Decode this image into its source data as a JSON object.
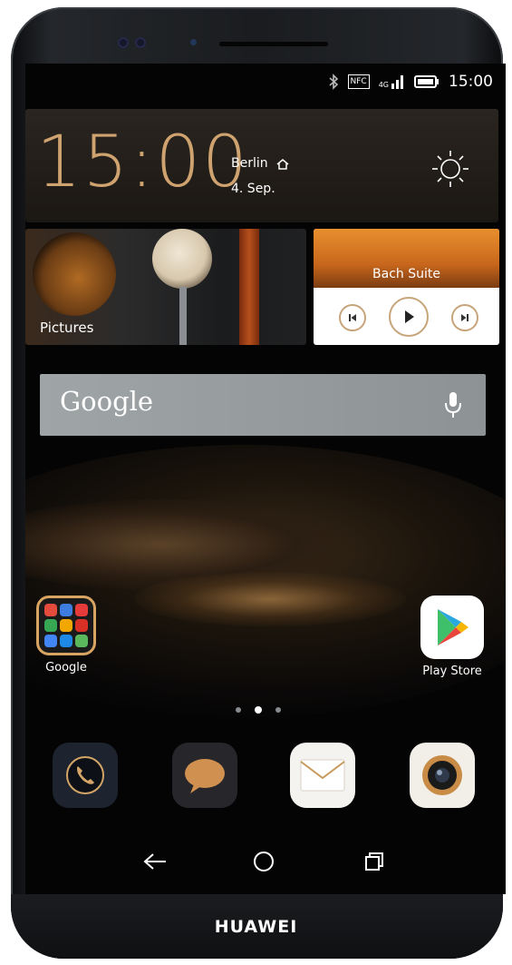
{
  "status_bar": {
    "time": "15:00",
    "nfc_label": "NFC",
    "network": "4G"
  },
  "clock_widget": {
    "time": "15:00",
    "city": "Berlin",
    "date": "4. Sep."
  },
  "pictures_widget": {
    "label": "Pictures"
  },
  "music_widget": {
    "title": "Bach Suite"
  },
  "search": {
    "label": "Google"
  },
  "apps": [
    {
      "label": "Google"
    },
    {
      "label": "Play Store"
    }
  ],
  "page_indicator": {
    "count": 3,
    "active": 2
  },
  "brand": {
    "label": "HUAWEI"
  },
  "colors": {
    "clock_accent": "#cfa36f",
    "play_ring": "#c7a47a",
    "folder_border": "#d7a461"
  }
}
